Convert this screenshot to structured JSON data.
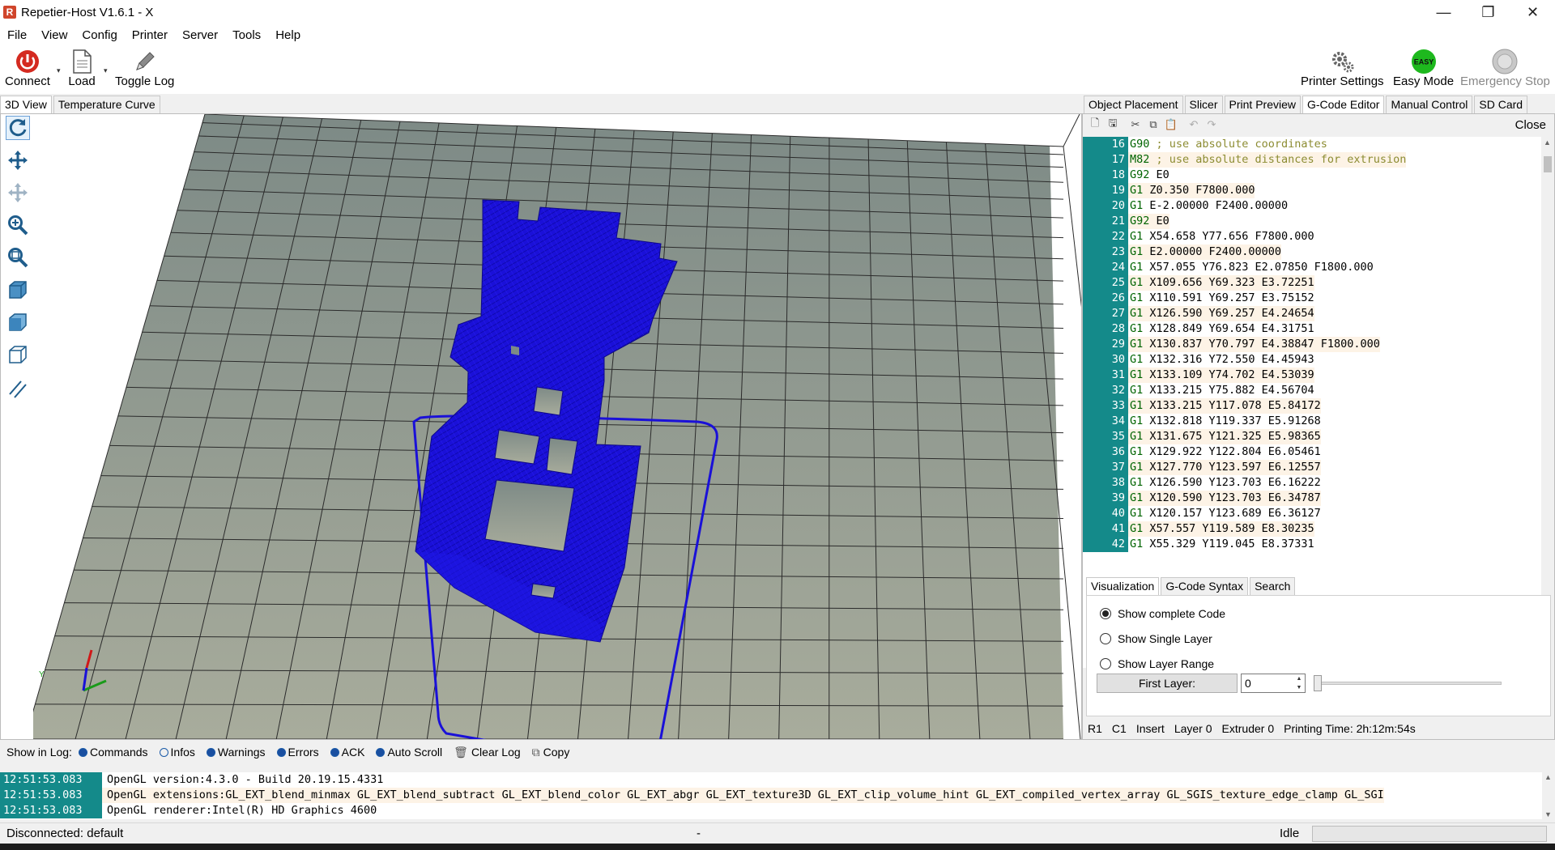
{
  "window": {
    "title": "Repetier-Host V1.6.1 - X",
    "app_icon": "R"
  },
  "window_controls": {
    "minimize": "—",
    "restore": "❐",
    "close": "✕"
  },
  "menu": [
    "File",
    "View",
    "Config",
    "Printer",
    "Server",
    "Tools",
    "Help"
  ],
  "toolbar": {
    "connect": "Connect",
    "load": "Load",
    "toggle_log": "Toggle Log",
    "printer_settings": "Printer Settings",
    "easy_mode": "Easy Mode",
    "easy_badge": "EASY",
    "emergency_stop": "Emergency Stop"
  },
  "left_tabs": [
    "3D View",
    "Temperature Curve"
  ],
  "right_tabs": [
    "Object Placement",
    "Slicer",
    "Print Preview",
    "G-Code Editor",
    "Manual Control",
    "SD Card"
  ],
  "editor": {
    "close": "Close",
    "lines": [
      {
        "n": "16",
        "cmd": "G90",
        "params": "",
        "comment": "; use absolute coordinates"
      },
      {
        "n": "17",
        "cmd": "M82",
        "params": "",
        "comment": "; use absolute distances for extrusion"
      },
      {
        "n": "18",
        "cmd": "G92",
        "params": "E0",
        "comment": ""
      },
      {
        "n": "19",
        "cmd": "G1",
        "params": "Z0.350 F7800.000",
        "comment": ""
      },
      {
        "n": "20",
        "cmd": "G1",
        "params": "E-2.00000 F2400.00000",
        "comment": ""
      },
      {
        "n": "21",
        "cmd": "G92",
        "params": "E0",
        "comment": ""
      },
      {
        "n": "22",
        "cmd": "G1",
        "params": "X54.658 Y77.656 F7800.000",
        "comment": ""
      },
      {
        "n": "23",
        "cmd": "G1",
        "params": "E2.00000 F2400.00000",
        "comment": ""
      },
      {
        "n": "24",
        "cmd": "G1",
        "params": "X57.055 Y76.823 E2.07850 F1800.000",
        "comment": ""
      },
      {
        "n": "25",
        "cmd": "G1",
        "params": "X109.656 Y69.323 E3.72251",
        "comment": ""
      },
      {
        "n": "26",
        "cmd": "G1",
        "params": "X110.591 Y69.257 E3.75152",
        "comment": ""
      },
      {
        "n": "27",
        "cmd": "G1",
        "params": "X126.590 Y69.257 E4.24654",
        "comment": ""
      },
      {
        "n": "28",
        "cmd": "G1",
        "params": "X128.849 Y69.654 E4.31751",
        "comment": ""
      },
      {
        "n": "29",
        "cmd": "G1",
        "params": "X130.837 Y70.797 E4.38847 F1800.000",
        "comment": ""
      },
      {
        "n": "30",
        "cmd": "G1",
        "params": "X132.316 Y72.550 E4.45943",
        "comment": ""
      },
      {
        "n": "31",
        "cmd": "G1",
        "params": "X133.109 Y74.702 E4.53039",
        "comment": ""
      },
      {
        "n": "32",
        "cmd": "G1",
        "params": "X133.215 Y75.882 E4.56704",
        "comment": ""
      },
      {
        "n": "33",
        "cmd": "G1",
        "params": "X133.215 Y117.078 E5.84172",
        "comment": ""
      },
      {
        "n": "34",
        "cmd": "G1",
        "params": "X132.818 Y119.337 E5.91268",
        "comment": ""
      },
      {
        "n": "35",
        "cmd": "G1",
        "params": "X131.675 Y121.325 E5.98365",
        "comment": ""
      },
      {
        "n": "36",
        "cmd": "G1",
        "params": "X129.922 Y122.804 E6.05461",
        "comment": ""
      },
      {
        "n": "37",
        "cmd": "G1",
        "params": "X127.770 Y123.597 E6.12557",
        "comment": ""
      },
      {
        "n": "38",
        "cmd": "G1",
        "params": "X126.590 Y123.703 E6.16222",
        "comment": ""
      },
      {
        "n": "39",
        "cmd": "G1",
        "params": "X120.590 Y123.703 E6.34787",
        "comment": ""
      },
      {
        "n": "40",
        "cmd": "G1",
        "params": "X120.157 Y123.689 E6.36127",
        "comment": ""
      },
      {
        "n": "41",
        "cmd": "G1",
        "params": "X57.557 Y119.589 E8.30235",
        "comment": ""
      },
      {
        "n": "42",
        "cmd": "G1",
        "params": "X55.329 Y119.045 E8.37331",
        "comment": ""
      }
    ]
  },
  "viz_tabs": [
    "Visualization",
    "G-Code Syntax",
    "Search"
  ],
  "visualization": {
    "options": [
      "Show complete Code",
      "Show Single Layer",
      "Show Layer Range"
    ],
    "selected": 0,
    "first_layer_label": "First Layer:",
    "first_layer_value": "0"
  },
  "right_status": {
    "r": "R1",
    "c": "C1",
    "mode": "Insert",
    "layer": "Layer 0",
    "extruder": "Extruder 0",
    "print_time": "Printing Time: 2h:12m:54s"
  },
  "log_bar": {
    "label": "Show in Log:",
    "options": [
      "Commands",
      "Infos",
      "Warnings",
      "Errors",
      "ACK",
      "Auto Scroll"
    ],
    "clear": "Clear Log",
    "copy": "Copy"
  },
  "log": [
    {
      "ts": "12:51:53.083",
      "msg": "OpenGL version:4.3.0 - Build 20.19.15.4331"
    },
    {
      "ts": "12:51:53.083",
      "msg": "OpenGL extensions:GL_EXT_blend_minmax GL_EXT_blend_subtract GL_EXT_blend_color GL_EXT_abgr GL_EXT_texture3D GL_EXT_clip_volume_hint GL_EXT_compiled_vertex_array GL_SGIS_texture_edge_clamp GL_SGI"
    },
    {
      "ts": "12:51:53.083",
      "msg": "OpenGL renderer:Intel(R) HD Graphics 4600"
    }
  ],
  "status": {
    "connection": "Disconnected: default",
    "middle": "-",
    "state": "Idle"
  },
  "colors": {
    "model": "#1a10d8",
    "bed": "#8f9c90",
    "line_numbers": "#148a8a",
    "gcode_cmd": "#006400",
    "comment": "#8c8c32"
  }
}
